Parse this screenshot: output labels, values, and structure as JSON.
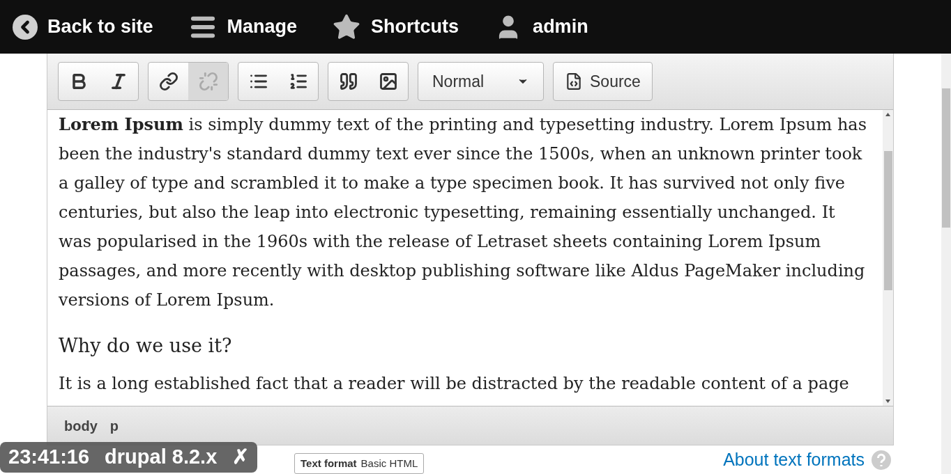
{
  "toolbar_top": [
    {
      "kind": "back",
      "label": "Back to site"
    },
    {
      "kind": "menu",
      "label": "Manage"
    },
    {
      "kind": "star",
      "label": "Shortcuts"
    },
    {
      "kind": "user",
      "label": "admin"
    }
  ],
  "editor": {
    "toolbar_groups": [
      [
        {
          "kind": "bold",
          "disabled": false
        },
        {
          "kind": "italic",
          "disabled": false
        }
      ],
      [
        {
          "kind": "link",
          "disabled": false
        },
        {
          "kind": "unlink",
          "disabled": true
        }
      ],
      [
        {
          "kind": "bulleted-list",
          "disabled": false
        },
        {
          "kind": "numbered-list",
          "disabled": false
        }
      ],
      [
        {
          "kind": "quote",
          "disabled": false
        },
        {
          "kind": "image",
          "disabled": false
        }
      ]
    ],
    "format_select": "Normal",
    "source_button": "Source",
    "content": [
      {
        "kind": "paragraph",
        "text": "**Lorem Ipsum** is simply dummy text of the printing and typesetting industry. Lorem Ipsum has been the industry's standard dummy text ever since the 1500s, when an unknown printer took a galley of type and scrambled it to make a type specimen book. It has survived not only five centuries, but also the leap into electronic typesetting, remaining essentially unchanged. It was popularised in the 1960s with the release of Letraset sheets containing Lorem Ipsum passages, and more recently with desktop publishing software like Aldus PageMaker including versions of Lorem Ipsum."
      },
      {
        "kind": "heading",
        "text": "Why do we use it?"
      },
      {
        "kind": "paragraph",
        "text": "It is a long established fact that a reader will be distracted by the readable content of a page"
      }
    ],
    "path": [
      "body",
      "p"
    ]
  },
  "text_format": {
    "label": "Text format",
    "value": "Basic HTML",
    "help_link": "About text formats"
  },
  "badge": {
    "time": "23:41:16",
    "version": "drupal 8.2.x",
    "close": "✗"
  }
}
